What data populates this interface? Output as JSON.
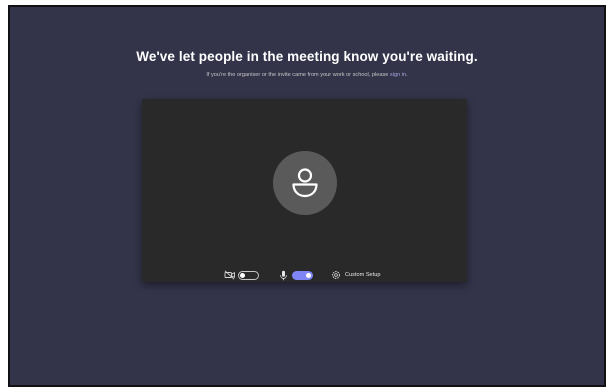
{
  "lobby": {
    "heading": "We've let people in the meeting know you're waiting.",
    "subtext_prefix": "If you're the organiser or the invite came from your work or school, please ",
    "sign_in_link": "sign in",
    "subtext_suffix": "."
  },
  "preview": {
    "avatar_icon": "person-icon",
    "camera_icon": "video-off-icon",
    "camera_on": false,
    "mic_icon": "microphone-icon",
    "mic_on": true,
    "settings_icon": "gear-icon",
    "custom_setup_label": "Custom Setup"
  },
  "colors": {
    "background": "#33344a",
    "preview_bg": "#292929",
    "avatar_bg": "#5a5a5a",
    "accent": "#7f85f5",
    "link": "#a6a7dc"
  }
}
